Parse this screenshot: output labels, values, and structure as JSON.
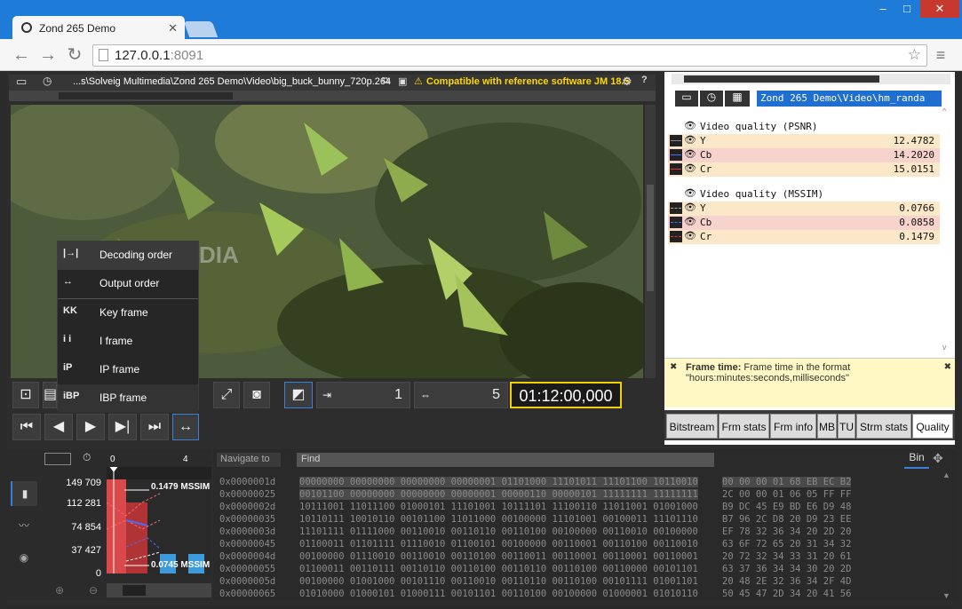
{
  "browser": {
    "tab_title": "Zond 265 Demo",
    "url_host": "127.0.0.1",
    "url_port": ":8091",
    "window_controls": [
      "–",
      "□",
      "✕"
    ]
  },
  "player": {
    "path": "...s\\Solveig Multimedia\\Zond 265 Demo\\Video\\big_buck_bunny_720p.264",
    "compat_text": "Compatible with reference software JM 18.5",
    "watermark": "SOFTPEDIA",
    "frame_current": "1",
    "frame_total": "5",
    "timecode": "01:12:00,000"
  },
  "menu": {
    "items": [
      {
        "label": "Decoding order",
        "icon": "decoding-order-icon",
        "glyph": "|→|"
      },
      {
        "label": "Output order",
        "icon": "output-order-icon",
        "glyph": "↔"
      },
      {
        "label": "Key frame",
        "icon": "key-frame-icon",
        "glyph": "KK"
      },
      {
        "label": "I frame",
        "icon": "i-frame-icon",
        "glyph": "i i"
      },
      {
        "label": "IP frame",
        "icon": "ip-frame-icon",
        "glyph": "iP"
      },
      {
        "label": "IBP frame",
        "icon": "ibp-frame-icon",
        "glyph": "iBP"
      }
    ]
  },
  "quality": {
    "path": "Zond 265 Demo\\Video\\hm_randa",
    "psnr_title": "Video quality (PSNR)",
    "psnr": [
      {
        "label": "Y",
        "value": "12.4782",
        "bg": "#fbe8c8"
      },
      {
        "label": "Cb",
        "value": "14.2020",
        "bg": "#f8d2cc"
      },
      {
        "label": "Cr",
        "value": "15.0151",
        "bg": "#fbe8c8"
      }
    ],
    "mssim_title": "Video quality (MSSIM)",
    "mssim": [
      {
        "label": "Y",
        "value": "0.0766",
        "bg": "#fbe8c8"
      },
      {
        "label": "Cb",
        "value": "0.0858",
        "bg": "#f8d2cc"
      },
      {
        "label": "Cr",
        "value": "0.1479",
        "bg": "#fbe8c8"
      }
    ]
  },
  "help": {
    "title": "Frame time:",
    "line1": "Frame time in the format",
    "line2": "\"hours:minutes:seconds,milliseconds\""
  },
  "tabs": [
    "Bitstream",
    "Frm stats",
    "Frm info",
    "MB",
    "TU",
    "Strm stats",
    "Quality"
  ],
  "graph": {
    "y_ticks": [
      "149 709",
      "112 281",
      "74 854",
      "37 427",
      "0"
    ],
    "x_ticks": [
      "0",
      "4"
    ],
    "label_top": "0.1479 MSSIM",
    "label_bottom": "0.0745 MSSIM"
  },
  "hex": {
    "navigate_label": "Navigate to",
    "find_label": "Find",
    "mode": "Bin",
    "rows": [
      {
        "addr": "0x0000001d",
        "bin": "00000000 00000000 00000000 00000001 01101000 11101011 11101100 10110010",
        "hex": "00 00 00 01 68 EB EC B2"
      },
      {
        "addr": "0x00000025",
        "bin": "00101100 00000000 00000000 00000001 00000110 00000101 11111111 11111111",
        "hex": "2C 00 00 01 06 05 FF FF"
      },
      {
        "addr": "0x0000002d",
        "bin": "10111001 11011100 01000101 11101001 10111101 11100110 11011001 01001000",
        "hex": "B9 DC 45 E9 BD E6 D9 48"
      },
      {
        "addr": "0x00000035",
        "bin": "10110111 10010110 00101100 11011000 00100000 11101001 00100011 11101110",
        "hex": "B7 96 2C D8 20 D9 23 EE"
      },
      {
        "addr": "0x0000003d",
        "bin": "11101111 01111000 00110010 00110110 00110100 00100000 00110010 00100000",
        "hex": "EF 78 32 36 34 20 2D 20"
      },
      {
        "addr": "0x00000045",
        "bin": "01100011 01101111 01110010 01100101 00100000 00110001 00110100 00110010",
        "hex": "63 6F 72 65 20 31 34 32"
      },
      {
        "addr": "0x0000004d",
        "bin": "00100000 01110010 00110010 00110100 00110011 00110001 00110001 00110001",
        "hex": "20 72 32 34 33 31 20 61"
      },
      {
        "addr": "0x00000055",
        "bin": "01100011 00110111 00110110 00110100 00110110 00110100 00110000 00101101",
        "hex": "63 37 36 34 34 30 20 2D"
      },
      {
        "addr": "0x0000005d",
        "bin": "00100000 01001000 00101110 00110010 00110110 00110100 00101111 01001101",
        "hex": "20 48 2E 32 36 34 2F 4D"
      },
      {
        "addr": "0x00000065",
        "bin": "01010000 01000101 01000111 00101101 00110100 00100000 01000001 01010110",
        "hex": "50 45 47 2D 34 20 41 56"
      }
    ]
  },
  "colors": {
    "accent": "#1e7bd7",
    "timecode_border": "#f0d000",
    "compat": "#ffd700"
  }
}
